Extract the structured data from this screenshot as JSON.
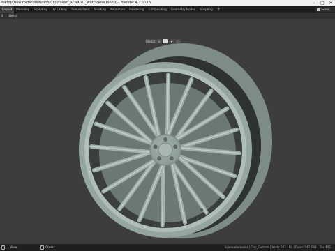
{
  "window": {
    "title": "esktop\\New folder\\BlendPro(08)\\ItalPro_XFNX-01_withScene.blend] - Blender 4.2.1 LTS",
    "controls": [
      "–",
      "□",
      "✕"
    ]
  },
  "workspace_tabs": [
    {
      "label": "Layout",
      "active": true
    },
    {
      "label": "Modeling",
      "active": false
    },
    {
      "label": "Sculpting",
      "active": false
    },
    {
      "label": "UV Editing",
      "active": false
    },
    {
      "label": "Texture Paint",
      "active": false
    },
    {
      "label": "Shading",
      "active": false
    },
    {
      "label": "Animation",
      "active": false
    },
    {
      "label": "Rendering",
      "active": false
    },
    {
      "label": "Compositing",
      "active": false
    },
    {
      "label": "Geometry Nodes",
      "active": false
    },
    {
      "label": "Scripting",
      "active": false
    }
  ],
  "add_tab_label": "+",
  "scene_selector": {
    "label": "Scene"
  },
  "header_menu": [
    "it",
    "Object"
  ],
  "viewport_tools": {
    "orientation": "Global",
    "icons": [
      "pivot-icon",
      "snap-icon",
      "snap-target-icon",
      "proportional-icon"
    ]
  },
  "statusbar": {
    "left": "... View",
    "middle": "Object",
    "right": "Scene.elements | Cap_Custom | Verts:243,180 | Faces:242,548 | Tris:442..."
  },
  "colors": {
    "viewport_bg": "#3d3d3d",
    "wheel_fill": "#8c9c98",
    "wheel_shadow": "#5f6d6a",
    "wheel_highlight": "#b3c1bd"
  }
}
